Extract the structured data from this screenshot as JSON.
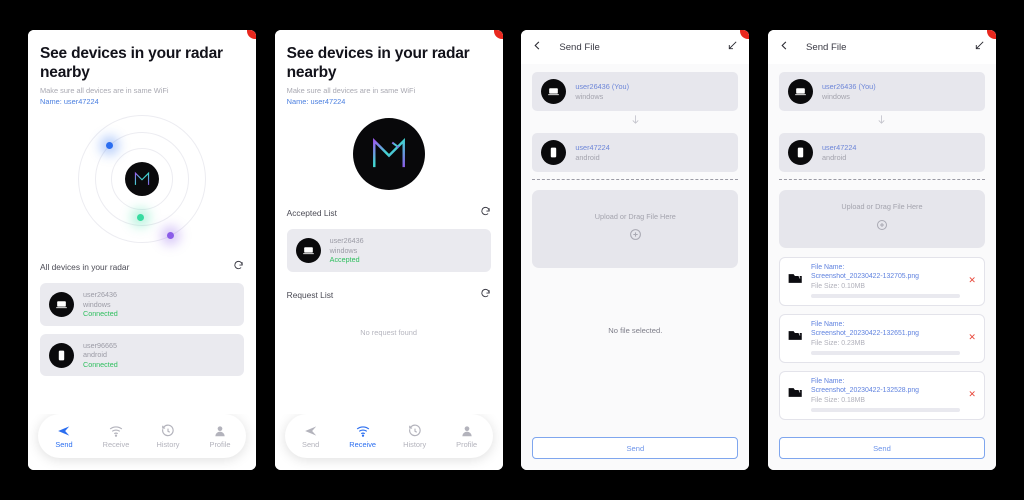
{
  "screen_radar": {
    "title": "See devices in your radar nearby",
    "subtitle": "Make sure all devices are in same WiFi",
    "name_line": "Name: user47224",
    "list_label": "All devices in your radar",
    "refresh_icon": "refresh-icon",
    "devices": [
      {
        "user": "user26436",
        "os": "windows",
        "status": "Connected",
        "icon": "laptop-icon"
      },
      {
        "user": "user96665",
        "os": "android",
        "status": "Connected",
        "icon": "phone-icon"
      }
    ],
    "radar_dots": [
      {
        "name": "radar-dot-blue",
        "color": "#2b6ef0"
      },
      {
        "name": "radar-dot-green",
        "color": "#36dba0"
      },
      {
        "name": "radar-dot-purple",
        "color": "#8b5ce8"
      }
    ]
  },
  "screen_receive": {
    "title": "See devices in your radar nearby",
    "subtitle": "Make sure all devices are in same WiFi",
    "name_line": "Name: user47224",
    "accepted_label": "Accepted List",
    "request_label": "Request List",
    "no_request_text": "No request found",
    "accepted": [
      {
        "user": "user26436",
        "os": "windows",
        "status": "Accepted",
        "icon": "laptop-icon"
      }
    ]
  },
  "nav": {
    "items": [
      {
        "label": "Send",
        "icon": "send-icon"
      },
      {
        "label": "Receive",
        "icon": "wifi-icon"
      },
      {
        "label": "History",
        "icon": "history-icon"
      },
      {
        "label": "Profile",
        "icon": "profile-icon"
      }
    ],
    "active_screen1": "Send",
    "active_screen2": "Receive"
  },
  "screen_send_empty": {
    "header_title": "Send File",
    "back_icon": "chevron-left-icon",
    "minimize_icon": "arrow-down-left-icon",
    "sender": {
      "user": "user26436 (You)",
      "os": "windows",
      "icon": "laptop-icon"
    },
    "receiver": {
      "user": "user47224",
      "os": "android",
      "icon": "phone-icon"
    },
    "transfer_arrow_icon": "arrow-down-icon",
    "dropzone_text": "Upload or Drag File Here",
    "dropzone_icon": "plus-circle-icon",
    "no_file_text": "No file selected.",
    "send_button": "Send"
  },
  "screen_send_files": {
    "header_title": "Send File",
    "back_icon": "chevron-left-icon",
    "minimize_icon": "arrow-down-left-icon",
    "sender": {
      "user": "user26436 (You)",
      "os": "windows",
      "icon": "laptop-icon"
    },
    "receiver": {
      "user": "user47224",
      "os": "android",
      "icon": "phone-icon"
    },
    "transfer_arrow_icon": "arrow-down-icon",
    "dropzone_text": "Upload or Drag File Here",
    "dropzone_icon": "plus-circle-icon",
    "file_name_label": "File Name:",
    "files": [
      {
        "name": "Screenshot_20230422-132705.png",
        "size": "File Size: 0.10MB",
        "remove_icon": "close-icon"
      },
      {
        "name": "Screenshot_20230422-132651.png",
        "size": "File Size: 0.23MB",
        "remove_icon": "close-icon"
      },
      {
        "name": "Screenshot_20230422-132528.png",
        "size": "File Size: 0.18MB",
        "remove_icon": "close-icon"
      }
    ],
    "send_button": "Send"
  },
  "colors": {
    "accent_blue": "#2b6ef0",
    "status_green": "#2ebf5e",
    "danger_red": "#e8483a",
    "card_gray": "#eaeaef",
    "notch_red": "#e8281e"
  }
}
